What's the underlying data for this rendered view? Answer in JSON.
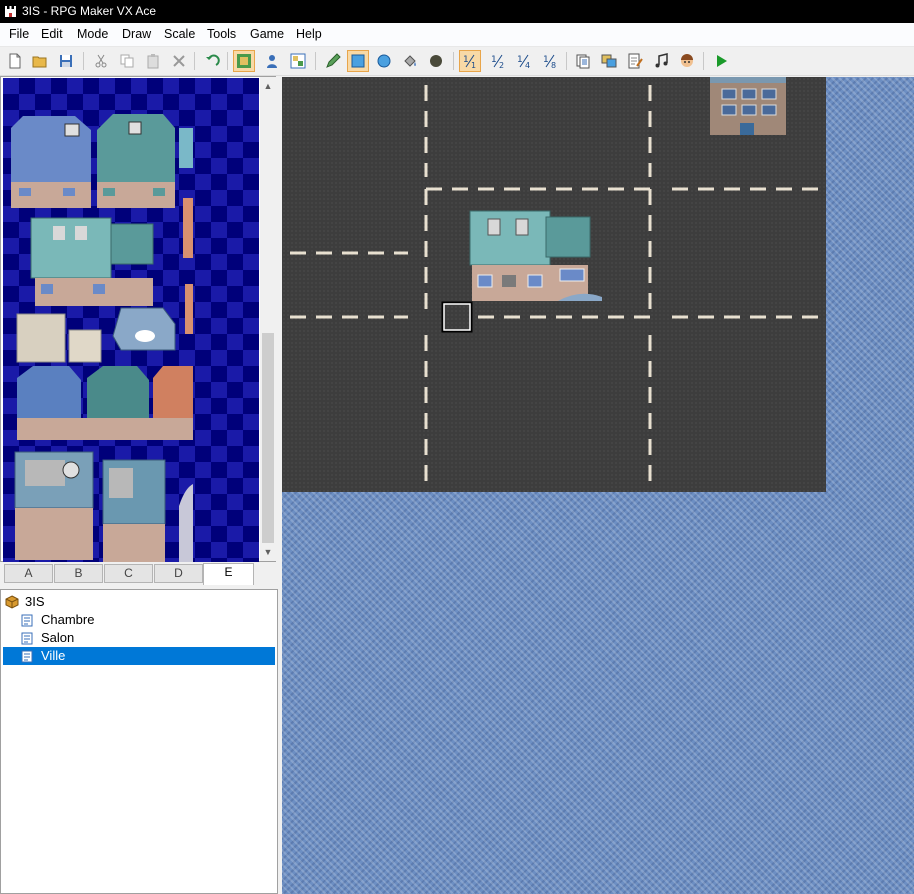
{
  "window": {
    "title": "3IS - RPG Maker VX Ace"
  },
  "menu": [
    "File",
    "Edit",
    "Mode",
    "Draw",
    "Scale",
    "Tools",
    "Game",
    "Help"
  ],
  "toolbar": {
    "buttons": [
      "new-project",
      "open-project",
      "save-project",
      "cut",
      "copy",
      "paste",
      "delete",
      "undo",
      "map-mode",
      "event-mode",
      "region-mode",
      "pencil",
      "rectangle",
      "ellipse",
      "flood-fill",
      "shadow-pen",
      "scale-1-1",
      "scale-1-2",
      "scale-1-4",
      "scale-1-8",
      "database",
      "resource-manager",
      "script-editor",
      "sound-test",
      "character-generator",
      "playtest"
    ],
    "scale_labels": [
      "1/1",
      "1/2",
      "1/4",
      "1/8"
    ]
  },
  "tileset": {
    "tabs": [
      "A",
      "B",
      "C",
      "D",
      "E"
    ],
    "active_tab": "E"
  },
  "map_tree": {
    "project": "3IS",
    "maps": [
      "Chambre",
      "Salon",
      "Ville"
    ],
    "selected": "Ville"
  },
  "colors": {
    "accent": "#0078d7",
    "tileset_bg": "#00008a",
    "asphalt": "#3d3d3d",
    "water": "#6d8fc3",
    "active_tool": "#f8d9a6"
  }
}
